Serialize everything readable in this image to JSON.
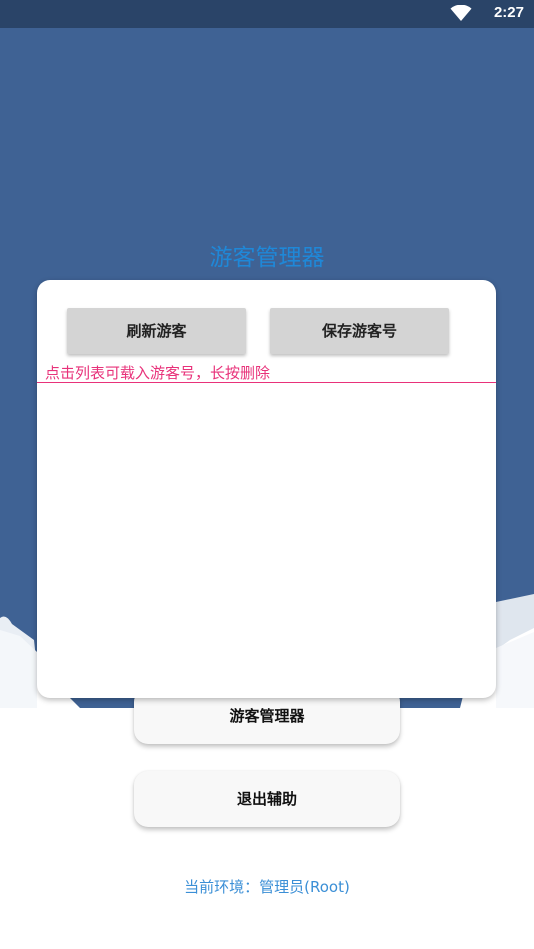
{
  "status_bar": {
    "time": "2:27",
    "wifi_icon": "wifi-icon"
  },
  "app": {
    "title": "游客管理器",
    "colors": {
      "header_bg": "#3f6294",
      "title": "#1f88d8",
      "hint": "#e8327a",
      "env": "#3b8fd6"
    }
  },
  "menu": {
    "guest_manager_label": "游客管理器",
    "exit_label": "退出辅助"
  },
  "environment": {
    "text": "当前环境：管理员(Root)"
  },
  "dialog": {
    "refresh_label": "刷新游客",
    "save_label": "保存游客号",
    "hint": "点击列表可载入游客号，长按删除",
    "list_items": []
  }
}
